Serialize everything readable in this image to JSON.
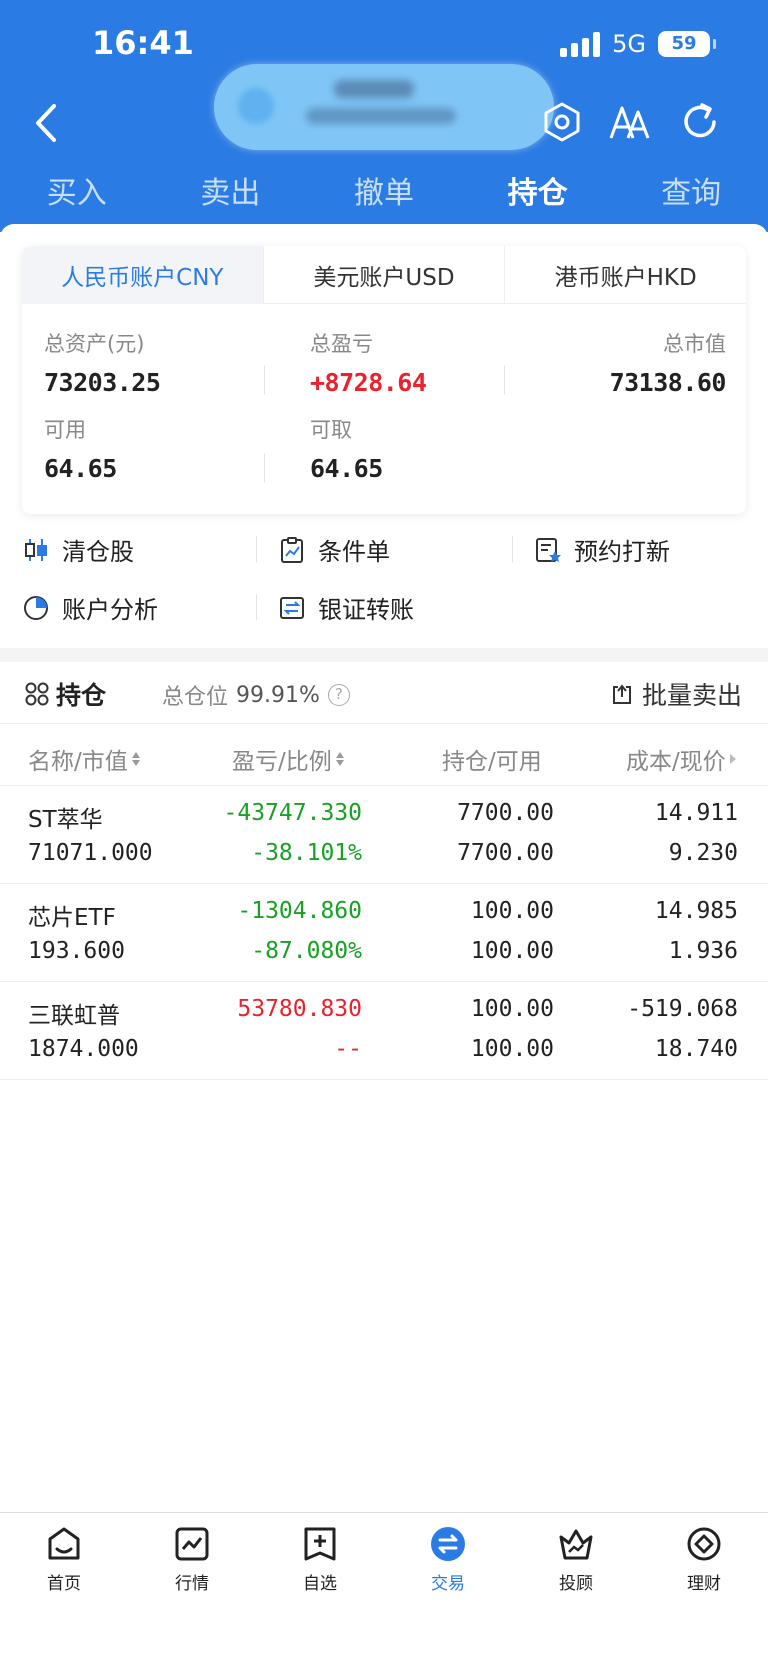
{
  "status_bar": {
    "time": "16:41",
    "network": "5G",
    "battery": "59"
  },
  "nav_tabs": [
    "买入",
    "卖出",
    "撤单",
    "持仓",
    "查询"
  ],
  "active_tab": "持仓",
  "account_tabs": [
    "人民币账户CNY",
    "美元账户USD",
    "港币账户HKD"
  ],
  "summary": {
    "total_assets": {
      "label": "总资产(元)",
      "value": "73203.25"
    },
    "total_pl": {
      "label": "总盈亏",
      "value": "+8728.64"
    },
    "market_value": {
      "label": "总市值",
      "value": "73138.60"
    },
    "available": {
      "label": "可用",
      "value": "64.65"
    },
    "withdrawable": {
      "label": "可取",
      "value": "64.65"
    }
  },
  "quick_actions": [
    "清仓股",
    "条件单",
    "预约打新",
    "账户分析",
    "银证转账"
  ],
  "positions_header": {
    "title": "持仓",
    "total_position_label": "总仓位",
    "total_position_value": "99.91%",
    "batch_sell": "批量卖出"
  },
  "columns": [
    "名称/市值",
    "盈亏/比例",
    "持仓/可用",
    "成本/现价"
  ],
  "positions": [
    {
      "name": "ST萃华",
      "market_value": "71071.000",
      "pl": "-43747.330",
      "pl_ratio": "-38.101%",
      "holding": "7700.00",
      "available": "7700.00",
      "cost": "14.911",
      "price": "9.230"
    },
    {
      "name": "芯片ETF",
      "market_value": "193.600",
      "pl": "-1304.860",
      "pl_ratio": "-87.080%",
      "holding": "100.00",
      "available": "100.00",
      "cost": "14.985",
      "price": "1.936"
    },
    {
      "name": "三联虹普",
      "market_value": "1874.000",
      "pl": "53780.830",
      "pl_ratio": "--",
      "holding": "100.00",
      "available": "100.00",
      "cost": "-519.068",
      "price": "18.740"
    }
  ],
  "bottom_tabs": [
    "首页",
    "行情",
    "自选",
    "交易",
    "投顾",
    "理财"
  ],
  "colors": {
    "brand": "#2a7be3",
    "up": "#e8232e",
    "down": "#18a124"
  }
}
